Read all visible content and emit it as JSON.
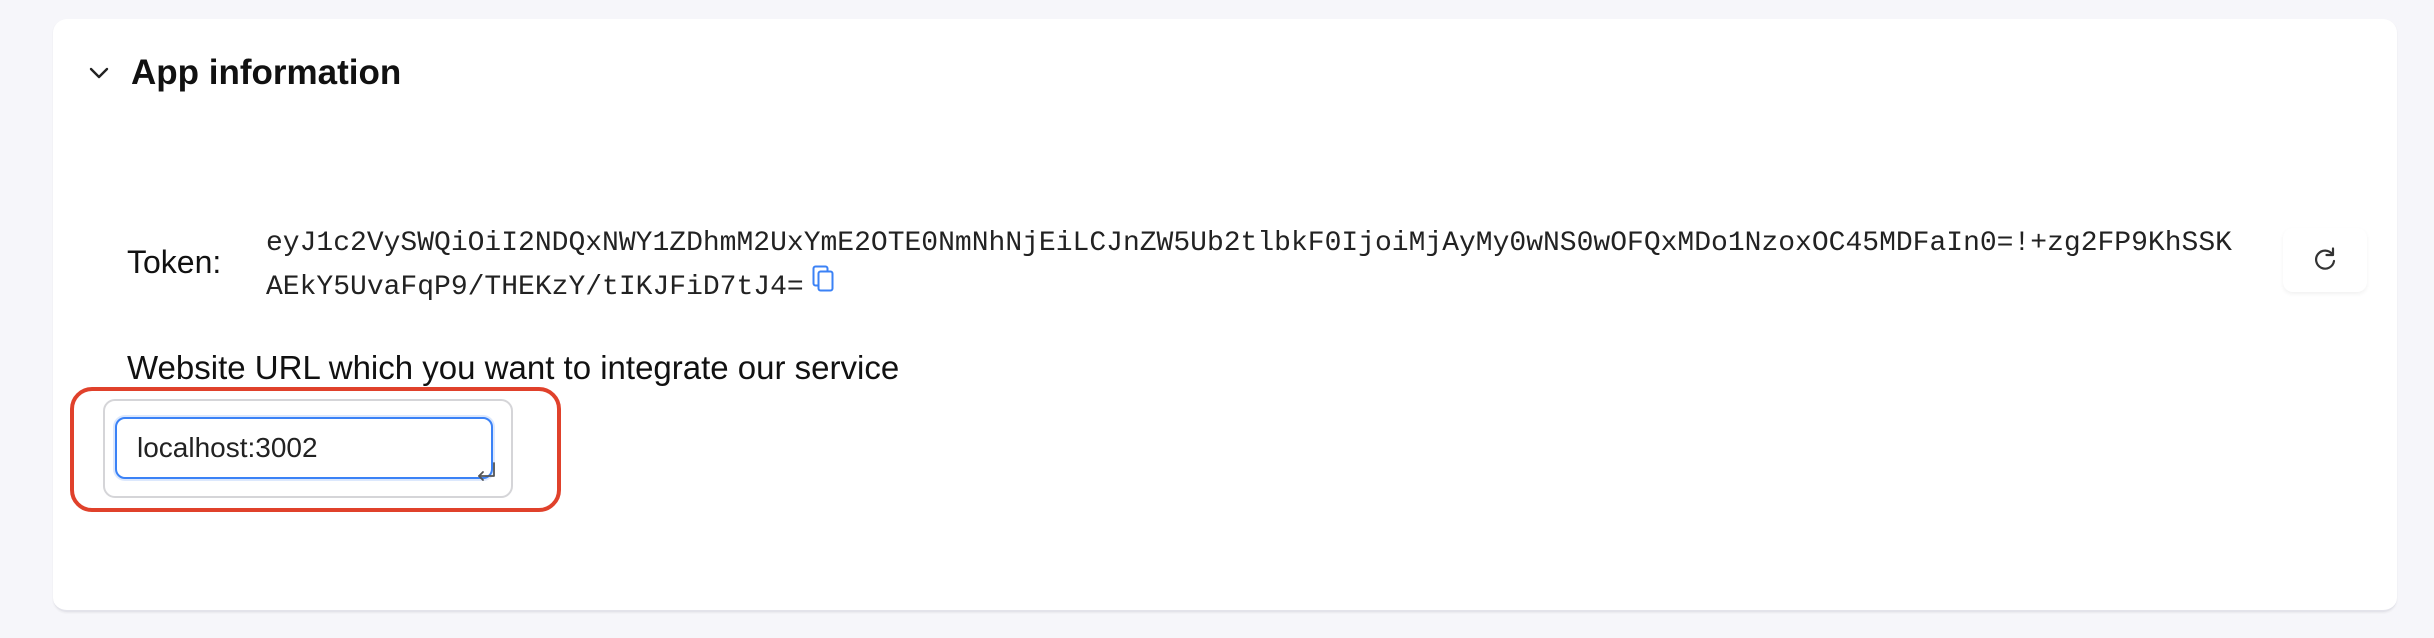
{
  "section": {
    "title": "App information",
    "collapse_icon": "chevron-down-icon"
  },
  "token": {
    "label": "Token:",
    "value": "eyJ1c2VySWQiOiI2NDQxNWY1ZDhmM2UxYmE2OTE0NmNhNjEiLCJnZW5Ub2tlbkF0IjoiMjAyMy0wNS0wOFQxMDo1NzoxOC45MDFaIn0=!+zg2FP9KhSSKAEkY5UvaFqP9/THEKzY/tIKJFiD7tJ4=",
    "copy_icon": "copy-icon",
    "refresh_icon": "refresh-icon"
  },
  "website": {
    "label": "Website URL which you want to integrate our service",
    "url_value": "localhost:3002",
    "enter_icon": "enter-icon"
  },
  "colors": {
    "highlight": "#e0412b",
    "input_focus": "#3b82f6",
    "copy_icon": "#3b82f6"
  }
}
